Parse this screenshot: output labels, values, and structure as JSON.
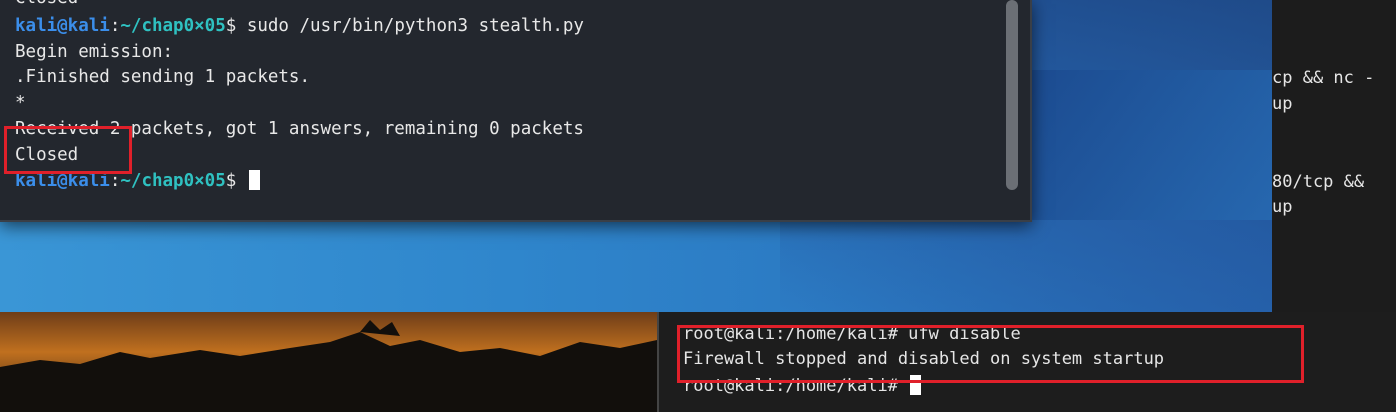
{
  "kali_terminal": {
    "top_partial": "Closed",
    "prompt1": {
      "user": "kali@kali",
      "sep": ":",
      "path": "~/chap0×05",
      "sym": "$",
      "command": " sudo /usr/bin/python3 stealth.py"
    },
    "out1": "Begin emission:",
    "out2": ".Finished sending 1 packets.",
    "out3": "*",
    "out4": "Received 2 packets, got 1 answers, remaining 0 packets",
    "out5": "Closed",
    "prompt2": {
      "user": "kali@kali",
      "sep": ":",
      "path": "~/chap0×05",
      "sym": "$"
    }
  },
  "right_terminal": {
    "l1": "cp && nc -",
    "l2": "up",
    "l3": "80/tcp &&",
    "l4": "up"
  },
  "root_terminal": {
    "l0": "",
    "l1": "root@kali:/home/kali# ufw disable",
    "l2": "Firewall stopped and disabled on system startup",
    "l3": "root@kali:/home/kali# "
  },
  "colors": {
    "highlight": "#e0202a",
    "prompt_user": "#3b8eea",
    "prompt_path": "#2fc1c1"
  }
}
